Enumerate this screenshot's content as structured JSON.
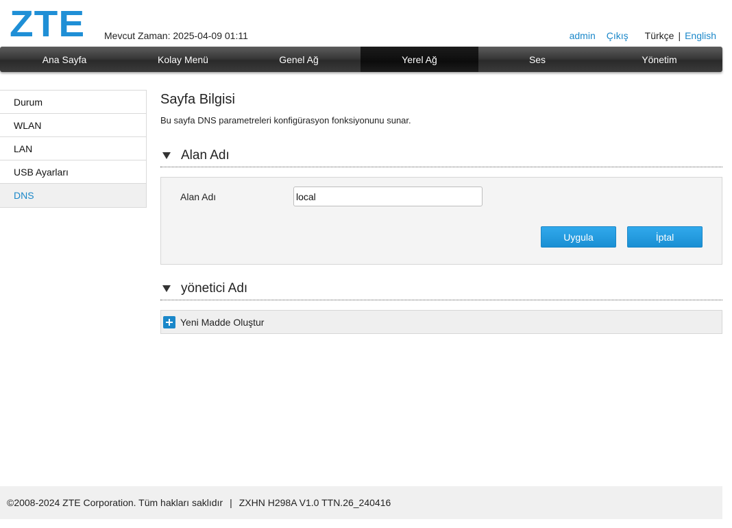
{
  "header": {
    "logo": "ZTE",
    "time_label": "Mevcut Zaman: 2025-04-09 01:11",
    "user": "admin",
    "logout": "Çıkış",
    "lang_current": "Türkçe",
    "lang_separator": "|",
    "lang_other": "English"
  },
  "nav": {
    "items": [
      {
        "label": "Ana Sayfa"
      },
      {
        "label": "Kolay Menü"
      },
      {
        "label": "Genel Ağ"
      },
      {
        "label": "Yerel Ağ"
      },
      {
        "label": "Ses"
      },
      {
        "label": "Yönetim"
      }
    ],
    "active": "Yerel Ağ"
  },
  "sidebar": {
    "items": [
      {
        "label": "Durum"
      },
      {
        "label": "WLAN"
      },
      {
        "label": "LAN"
      },
      {
        "label": "USB Ayarları"
      },
      {
        "label": "DNS"
      }
    ],
    "active": "DNS"
  },
  "main": {
    "title": "Sayfa Bilgisi",
    "description": "Bu sayfa DNS parametreleri konfigürasyon fonksiyonunu sunar.",
    "domain_section": {
      "title": "Alan Adı",
      "field_label": "Alan Adı",
      "field_value": "local",
      "apply_label": "Uygula",
      "cancel_label": "İptal"
    },
    "admin_section": {
      "title": "yönetici Adı",
      "create_label": "Yeni Madde Oluştur"
    }
  },
  "footer": {
    "copyright": "©2008-2024 ZTE Corporation. Tüm hakları saklıdır",
    "separator": "|",
    "version": "ZXHN H298A V1.0 TTN.26_240416"
  },
  "colors": {
    "accent": "#1a87c9",
    "button": "#1f96dc",
    "nav_bg": "#3a3a3a"
  },
  "icons": {
    "section_toggle": "triangle-down-icon",
    "create": "plus-icon"
  }
}
